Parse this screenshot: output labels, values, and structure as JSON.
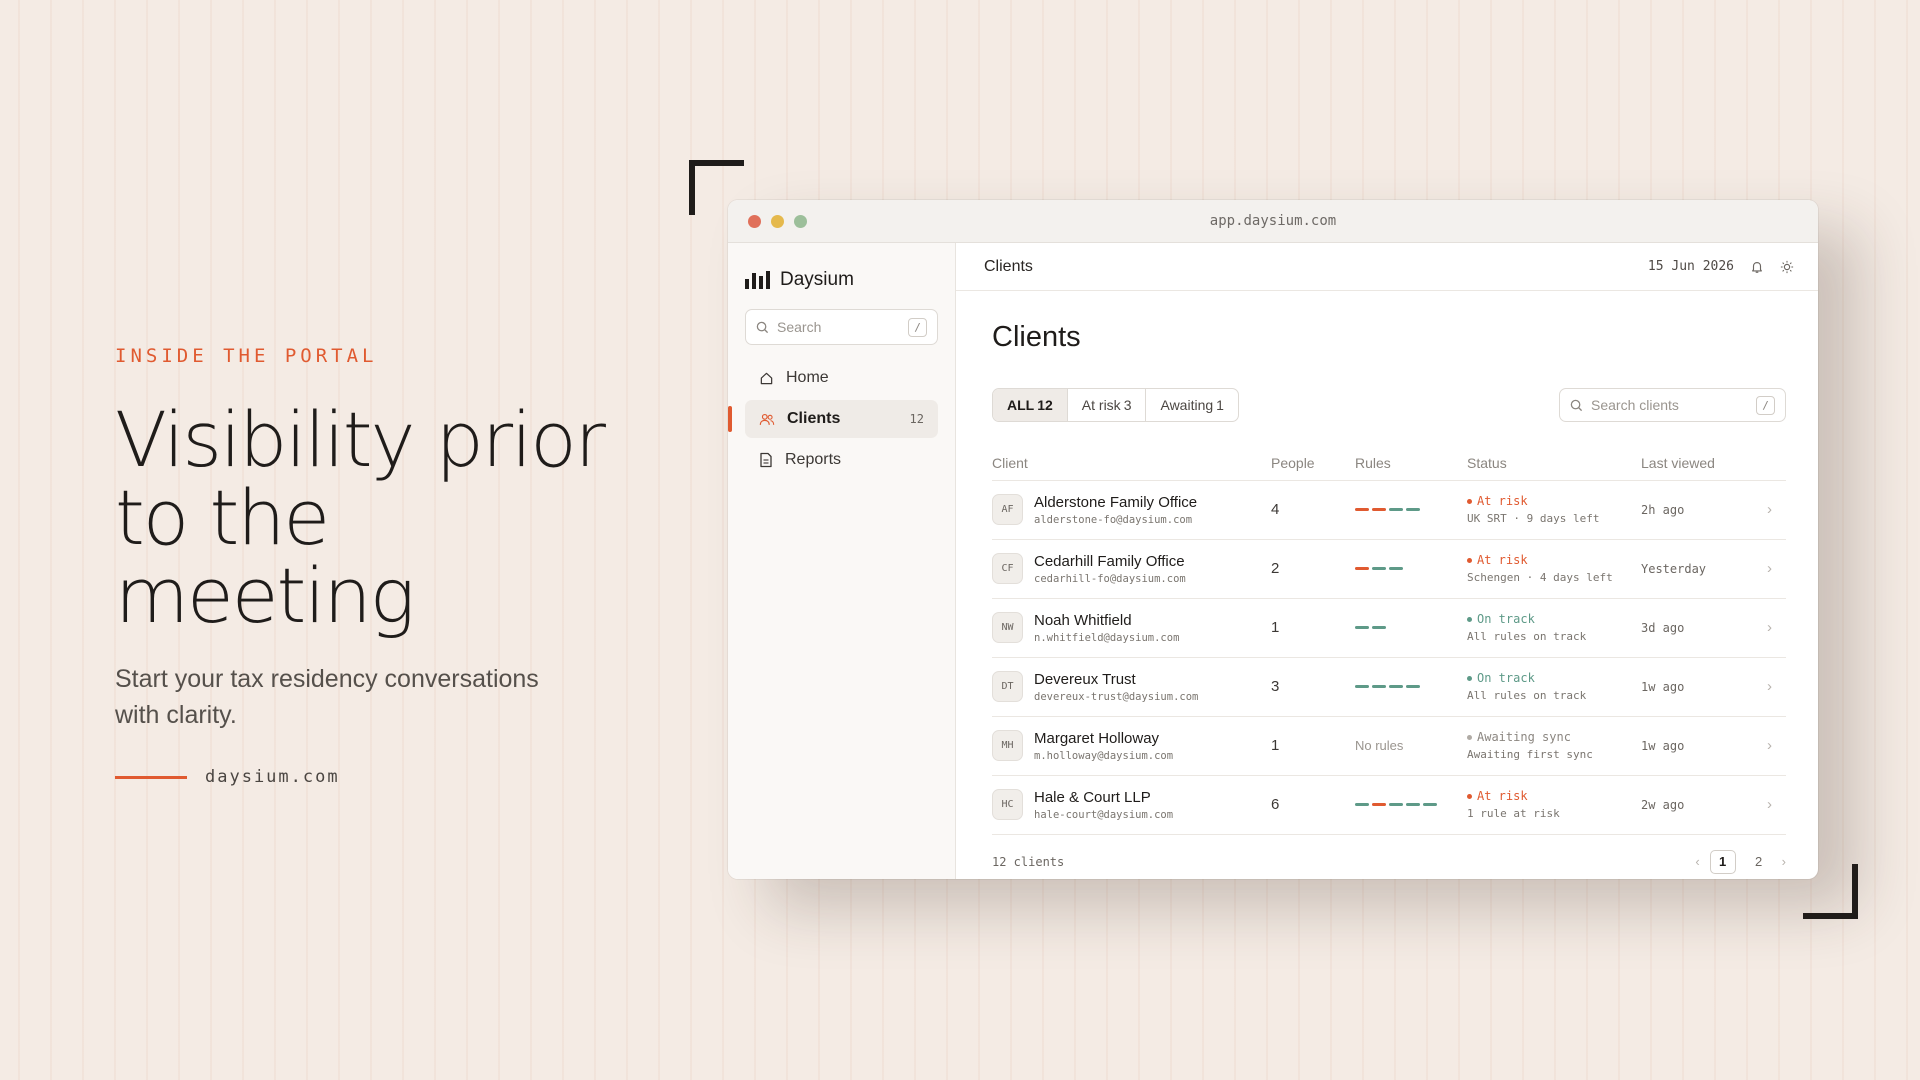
{
  "hero": {
    "eyebrow": "INSIDE THE PORTAL",
    "headline_line1": "Visibility prior",
    "headline_line2": "to the meeting",
    "subline": "Start your tax residency conversations with clarity.",
    "site": "daysium.com"
  },
  "colors": {
    "accent": "#e05a30",
    "on_track": "#5e9a88",
    "at_risk": "#e05a30",
    "neutral": "#b0aba5"
  },
  "window": {
    "url": "app.daysium.com",
    "traffic_lights": [
      "#e0705a",
      "#e5b94c",
      "#9cbf9a"
    ]
  },
  "sidebar": {
    "brand": "Daysium",
    "search_placeholder": "Search",
    "search_shortcut": "/",
    "items": [
      {
        "label": "Home",
        "icon": "home-icon"
      },
      {
        "label": "Clients",
        "icon": "users-icon",
        "count": "12",
        "active": true
      },
      {
        "label": "Reports",
        "icon": "document-icon"
      }
    ]
  },
  "topbar": {
    "title": "Clients",
    "date": "15 Jun 2026",
    "icons": [
      "bell-icon",
      "sun-icon"
    ]
  },
  "main": {
    "title": "Clients",
    "tabs": [
      {
        "label": "ALL",
        "count": "12",
        "active": true
      },
      {
        "label": "At risk",
        "count": "3"
      },
      {
        "label": "Awaiting",
        "count": "1"
      }
    ],
    "search_placeholder": "Search clients",
    "search_shortcut": "/",
    "columns": [
      "Client",
      "People",
      "Rules",
      "Status",
      "Last viewed"
    ],
    "rows": [
      {
        "initials": "AF",
        "name": "Alderstone Family Office",
        "email": "alderstone-fo@daysium.com",
        "people": "4",
        "rules": [
          "risk",
          "risk",
          "ok",
          "ok"
        ],
        "status": "At risk",
        "status_kind": "risk",
        "status_sub": "UK SRT · 9 days left",
        "last": "2h ago"
      },
      {
        "initials": "CF",
        "name": "Cedarhill Family Office",
        "email": "cedarhill-fo@daysium.com",
        "people": "2",
        "rules": [
          "risk",
          "ok",
          "ok"
        ],
        "status": "At risk",
        "status_kind": "risk",
        "status_sub": "Schengen · 4 days left",
        "last": "Yesterday"
      },
      {
        "initials": "NW",
        "name": "Noah Whitfield",
        "email": "n.whitfield@daysium.com",
        "people": "1",
        "rules": [
          "ok",
          "ok"
        ],
        "status": "On track",
        "status_kind": "ok",
        "status_sub": "All rules on track",
        "last": "3d ago"
      },
      {
        "initials": "DT",
        "name": "Devereux Trust",
        "email": "devereux-trust@daysium.com",
        "people": "3",
        "rules": [
          "ok",
          "ok",
          "ok",
          "ok"
        ],
        "status": "On track",
        "status_kind": "ok",
        "status_sub": "All rules on track",
        "last": "1w ago"
      },
      {
        "initials": "MH",
        "name": "Margaret Holloway",
        "email": "m.holloway@daysium.com",
        "people": "1",
        "rules": [],
        "rules_empty": "No rules",
        "status": "Awaiting sync",
        "status_kind": "neutral",
        "status_sub": "Awaiting first sync",
        "last": "1w ago"
      },
      {
        "initials": "HC",
        "name": "Hale & Court LLP",
        "email": "hale-court@daysium.com",
        "people": "6",
        "rules": [
          "ok",
          "risk",
          "ok",
          "ok",
          "ok"
        ],
        "status": "At risk",
        "status_kind": "risk",
        "status_sub": "1 rule at risk",
        "last": "2w ago"
      }
    ],
    "footer_count": "12 clients",
    "pages": [
      "1",
      "2"
    ],
    "current_page": "1"
  }
}
